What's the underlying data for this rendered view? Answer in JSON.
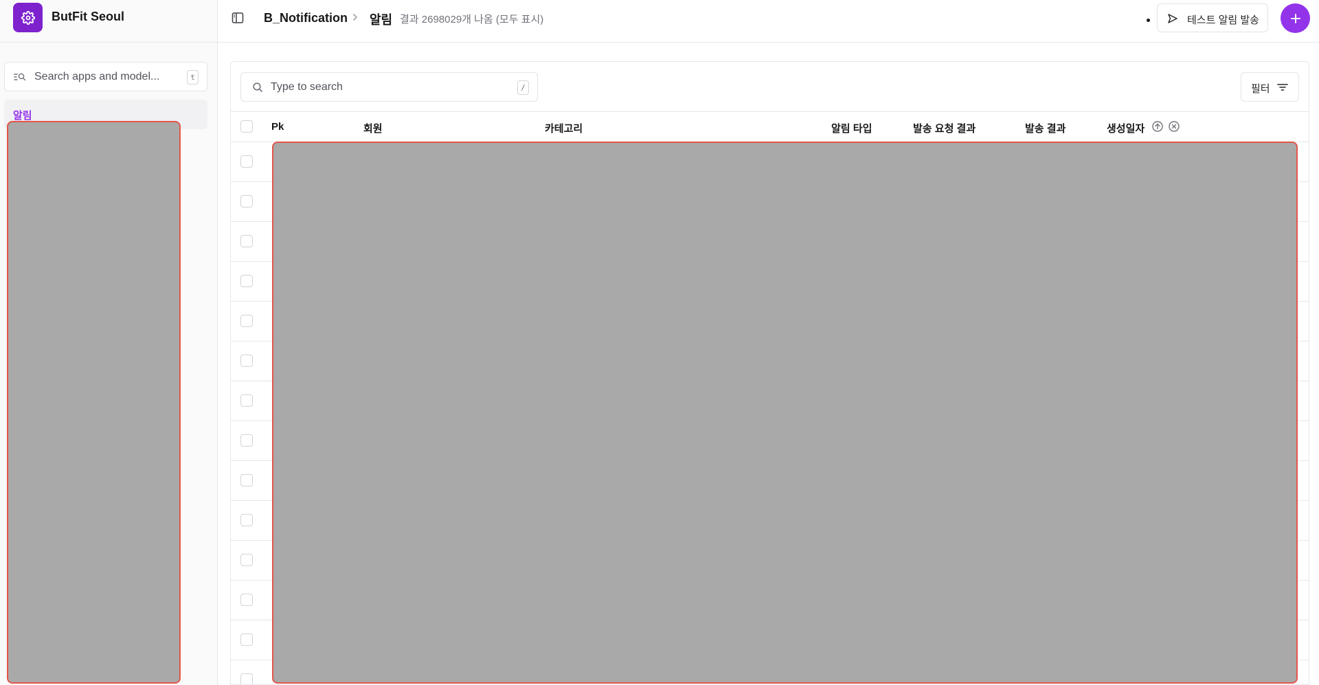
{
  "sidebar": {
    "brand_name": "ButFit Seoul",
    "search_placeholder": "Search apps and model...",
    "search_shortcut": "t",
    "nav_items": [
      {
        "label": "알림"
      }
    ]
  },
  "header": {
    "app_name": "B_Notification",
    "model_name": "알림",
    "result_count": "결과 2698029개 나옴 (모두 표시)",
    "test_button_label": "테스트 알림 발송"
  },
  "table": {
    "search_placeholder": "Type to search",
    "search_shortcut": "/",
    "filter_label": "필터",
    "columns": [
      "Pk",
      "회원",
      "카테고리",
      "알림 타입",
      "발송 요청 결과",
      "발송 결과",
      "생성일자"
    ],
    "row_count_visible": 14
  },
  "colors": {
    "accent": "#9333ea",
    "redaction": "#a9a9a9",
    "redaction_border": "#e4554a"
  }
}
